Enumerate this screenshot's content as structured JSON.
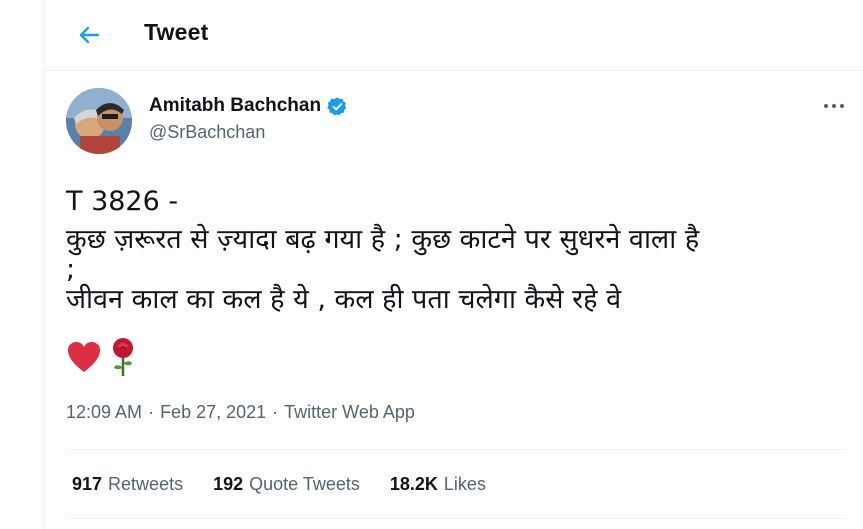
{
  "header": {
    "title": "Tweet",
    "back_icon": "arrow-left-icon"
  },
  "author": {
    "name": "Amitabh Bachchan",
    "handle": "@SrBachchan",
    "verified": true,
    "verified_icon": "verified-badge-icon"
  },
  "tweet": {
    "lines": [
      "T 3826 -",
      "कुछ ज़रूरत से ज़्यादा बढ़ गया है ; कुछ काटने पर सुधरने वाला है",
      ";",
      "जीवन काल का कल है ये , कल ही पता चलेगा कैसे रहे वे"
    ],
    "emojis": [
      "heart-emoji",
      "rose-emoji"
    ],
    "time": "12:09 AM",
    "date": "Feb 27, 2021",
    "source": "Twitter Web App",
    "separator": "·"
  },
  "stats": {
    "retweets_count": "917",
    "retweets_label": "Retweets",
    "quotes_count": "192",
    "quotes_label": "Quote Tweets",
    "likes_count": "18.2K",
    "likes_label": "Likes"
  },
  "colors": {
    "accent": "#1d9bf0",
    "text": "#0f1419",
    "muted": "#536471",
    "border": "#eff3f4"
  }
}
